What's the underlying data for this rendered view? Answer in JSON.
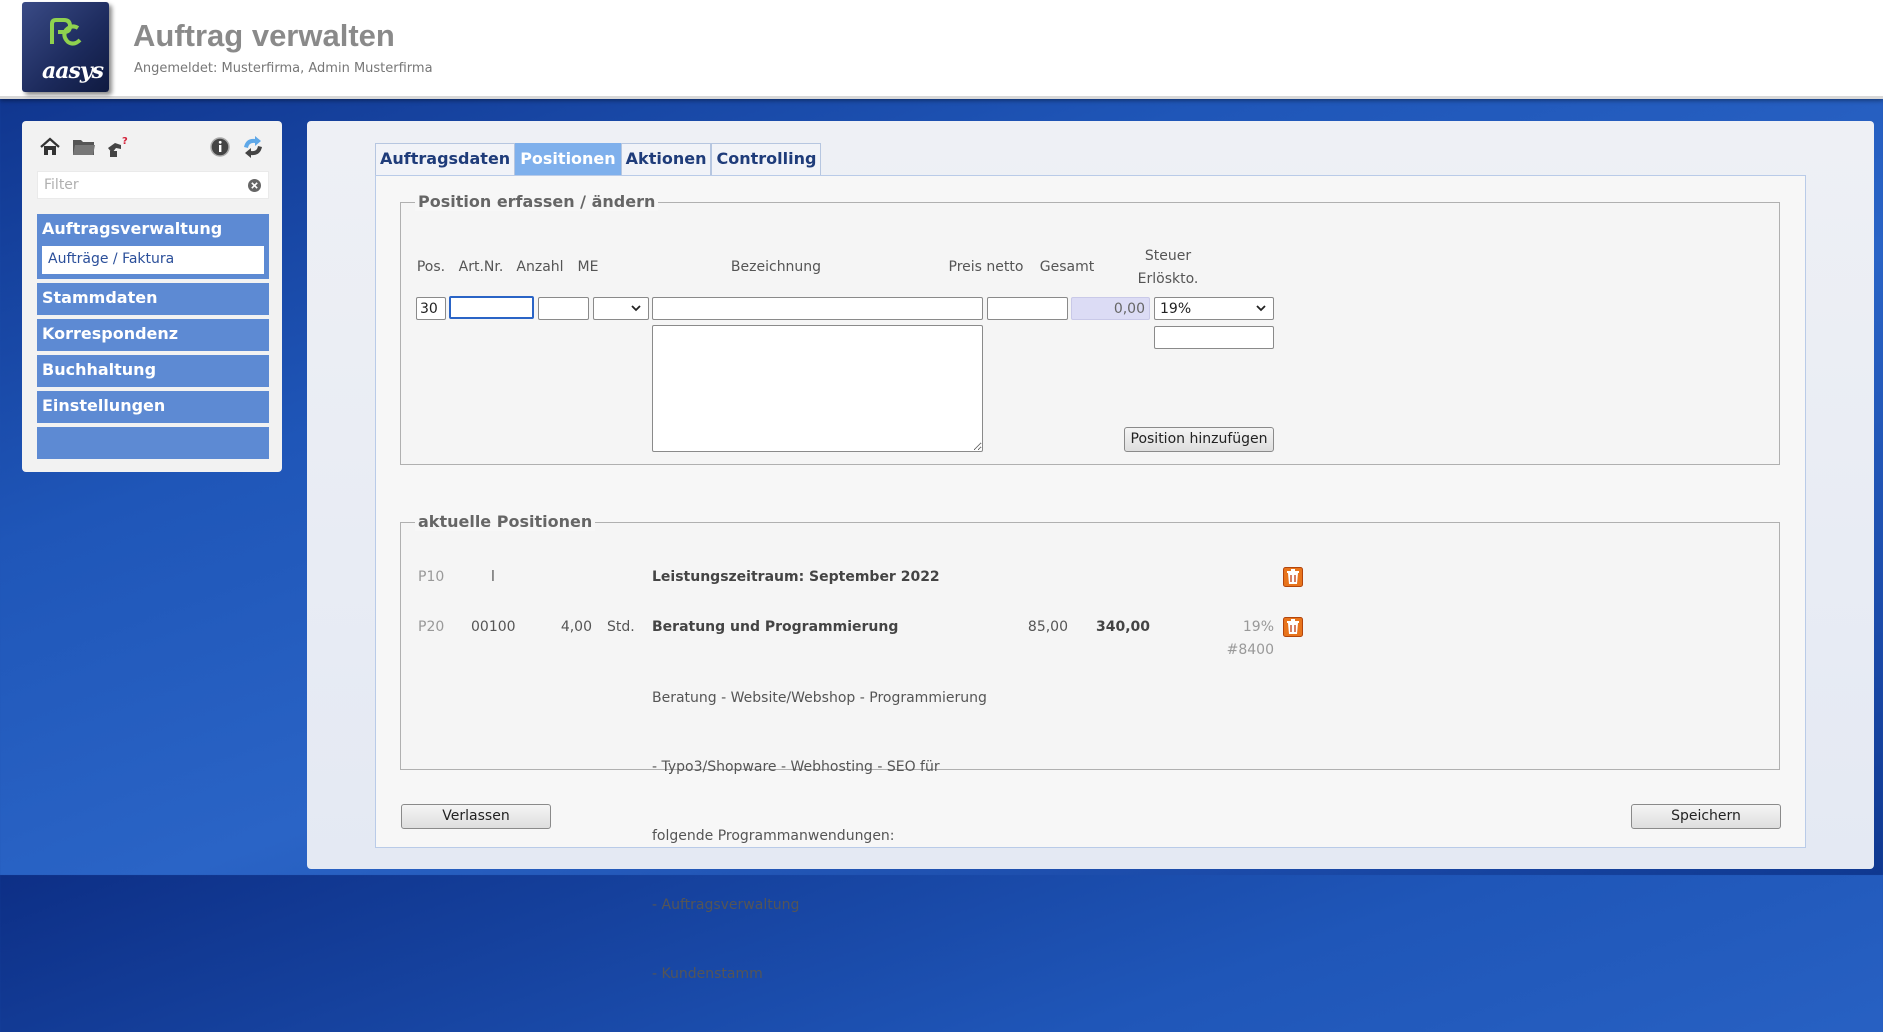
{
  "header": {
    "title": "Auftrag verwalten",
    "subtitle": "Angemeldet: Musterfirma, Admin Musterfirma",
    "logo_text": "aasys"
  },
  "sidebar": {
    "icons": [
      "home-icon",
      "folder-icon",
      "hand-help-icon",
      "info-icon",
      "refresh-icon"
    ],
    "filter_placeholder": "Filter",
    "groups": [
      {
        "label": "Auftragsverwaltung",
        "open": true,
        "items": [
          {
            "label": "Aufträge / Faktura"
          }
        ]
      },
      {
        "label": "Stammdaten"
      },
      {
        "label": "Korrespondenz"
      },
      {
        "label": "Buchhaltung"
      },
      {
        "label": "Einstellungen"
      }
    ]
  },
  "tabs": [
    {
      "label": "Auftragsdaten",
      "active": false
    },
    {
      "label": "Positionen",
      "active": true
    },
    {
      "label": "Aktionen",
      "active": false
    },
    {
      "label": "Controlling",
      "active": false
    }
  ],
  "form": {
    "legend": "Position erfassen / ändern",
    "columns": {
      "pos": "Pos.",
      "artnr": "Art.Nr.",
      "anzahl": "Anzahl",
      "me": "ME",
      "bezeichnung": "Bezeichnung",
      "preis": "Preis netto",
      "gesamt": "Gesamt",
      "steuer_line1": "Steuer",
      "steuer_line2": "Erlöskto."
    },
    "values": {
      "pos": "30",
      "artnr": "",
      "anzahl": "",
      "me": "",
      "bezeichnung": "",
      "preis": "",
      "gesamt": "0,00",
      "steuer": "19%",
      "erloeskonto": ""
    },
    "add_button": "Position hinzufügen"
  },
  "positions": {
    "legend": "aktuelle Positionen",
    "rows": [
      {
        "pos": "P10",
        "artnr": "l",
        "anzahl": "",
        "me": "",
        "title": "Leistungszeitraum: September 2022",
        "description": [],
        "preis": "",
        "gesamt": "",
        "steuer": "",
        "konto": ""
      },
      {
        "pos": "P20",
        "artnr": "00100",
        "anzahl": "4,00",
        "me": "Std.",
        "title": "Beratung und Programmierung",
        "description": [
          "Beratung - Website/Webshop - Programmierung",
          "- Typo3/Shopware - Webhosting - SEO für",
          "folgende Programmanwendungen:",
          "- Auftragsverwaltung",
          "- Kundenstamm"
        ],
        "preis": "85,00",
        "gesamt": "340,00",
        "steuer": "19%",
        "konto": "#8400"
      }
    ]
  },
  "footer": {
    "leave_button": "Verlassen",
    "save_button": "Speichern"
  },
  "colors": {
    "accent": "#5d8ad3",
    "tab_active": "#7fb0ec",
    "focus": "#2a64c6"
  }
}
